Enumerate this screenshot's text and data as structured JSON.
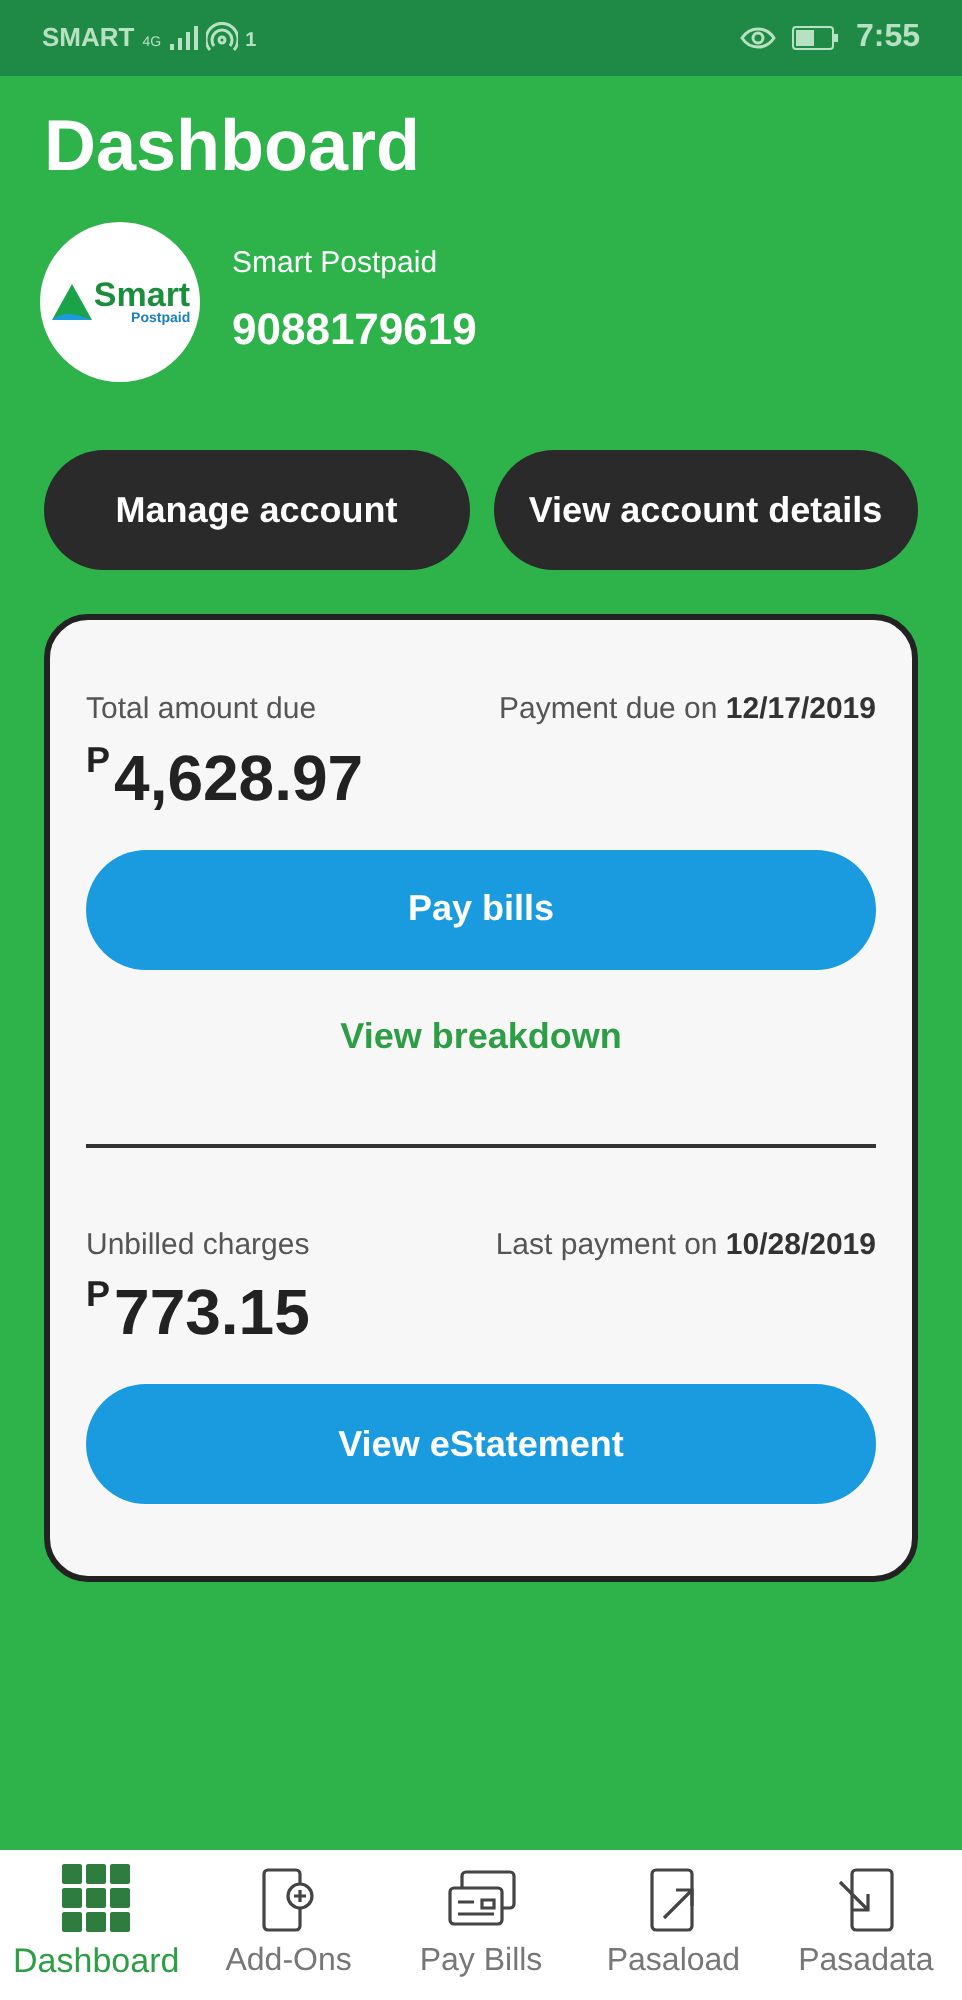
{
  "status_bar": {
    "carrier": "SMART",
    "network": "4G",
    "hotspot_count": "1",
    "time": "7:55"
  },
  "title": "Dashboard",
  "account": {
    "logo_word": "Smart",
    "logo_sub": "Postpaid",
    "plan": "Smart Postpaid",
    "number": "9088179619"
  },
  "actions": [
    "Manage account",
    "View account details"
  ],
  "bill": {
    "label": "Total amount due",
    "due_label": "Payment due on ",
    "due_date": "12/17/2019",
    "currency": "P",
    "amount": "4,628.97",
    "button": "Pay bills",
    "link": "View breakdown"
  },
  "unbilled": {
    "label": "Unbilled charges",
    "last_label": "Last payment on ",
    "last_date": "10/28/2019",
    "currency": "P",
    "amount": "773.15",
    "button": "View eStatement"
  },
  "nav": [
    {
      "kind": "grid",
      "label": "Dashboard",
      "selected": true
    },
    {
      "kind": "addon",
      "label": "Add-Ons",
      "selected": false
    },
    {
      "kind": "cards",
      "label": "Pay Bills",
      "selected": false
    },
    {
      "kind": "send",
      "label": "Pasaload",
      "selected": false
    },
    {
      "kind": "receive",
      "label": "Pasadata",
      "selected": false
    }
  ]
}
